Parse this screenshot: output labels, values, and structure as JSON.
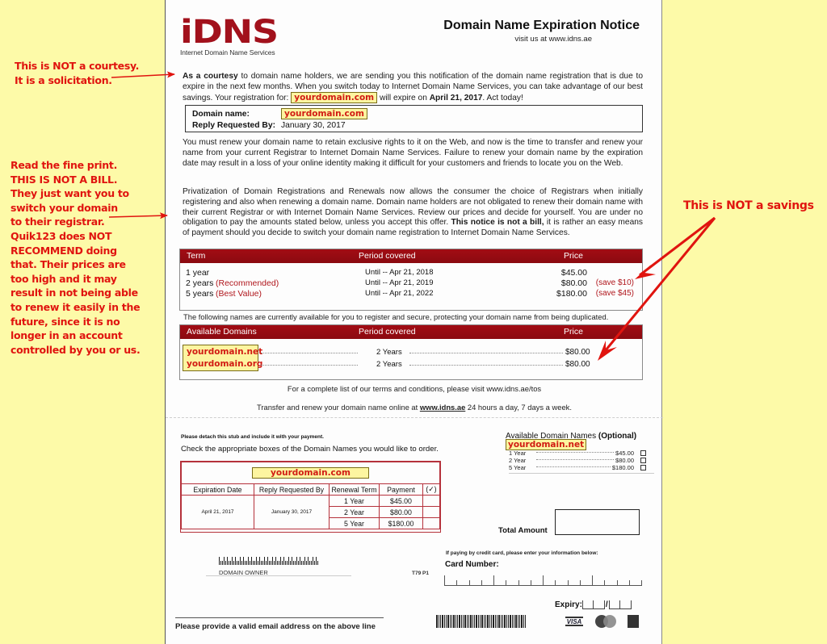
{
  "annotations": {
    "note1": [
      "This is NOT a courtesy.",
      "It is a solicitation."
    ],
    "note2": [
      "Read the fine print.",
      "THIS IS NOT A BILL.",
      "They just want you to",
      "switch your domain",
      "to their registrar.",
      "Quik123 does NOT",
      "RECOMMEND doing",
      "that.  Their prices are",
      "too high and it may",
      "result in not being able",
      "to renew it easily in the",
      "future, since it is no",
      "longer in an account",
      "controlled by you or us."
    ],
    "note3": "This is NOT a savings",
    "accent_color": "#e0140f"
  },
  "header": {
    "logo_text": "iDNS",
    "logo_subtitle": "Internet Domain Name Services",
    "title": "Domain Name Expiration Notice",
    "visit": "visit us at www.idns.ae",
    "brand_color": "#a2111c"
  },
  "intro": {
    "bold_lead": "As a courtesy",
    "text1": " to domain name holders, we are sending you this notification of the domain name registration that is due to expire in the next few months. When you switch today to Internet Domain Name Services, you can take advantage of our best savings. Your registration for: ",
    "domain": "yourdomain.com",
    "text2": " will expire on ",
    "expire_date": "April 21, 2017",
    "text3": ". Act today!"
  },
  "info": {
    "domain_label": "Domain name:",
    "domain_value": "yourdomain.com",
    "reply_label": "Reply Requested By:",
    "reply_value": "January 30, 2017"
  },
  "para2": "You must renew your domain name to retain exclusive rights to it on the Web, and now is the time to transfer and renew your name from your current Registrar to Internet Domain Name Services. Failure to renew your domain name by the expiration date may result in a loss of your online identity making it difficult for your customers and friends to locate you on the Web.",
  "para3": {
    "text1": "Privatization of Domain Registrations and Renewals now allows the consumer the choice of Registrars when initially registering and also when renewing a domain name. Domain name holders are not obligated to renew their domain name with their current Registrar or with Internet Domain Name Services. Review our prices and decide for yourself. You are under no obligation to pay the amounts stated below, unless you accept this offer. ",
    "bold": "This notice is not a bill,",
    "text2": " it is rather an easy means of payment should you decide to switch your domain name registration to Internet Domain Name Services."
  },
  "term_table": {
    "headers": [
      "Term",
      "Period covered",
      "Price"
    ],
    "rows": [
      {
        "term": "1 year",
        "note": "",
        "period": "Until -- Apr 21, 2018",
        "price": "$45.00",
        "save": ""
      },
      {
        "term": "2 years",
        "note": "(Recommended)",
        "period": "Until -- Apr 21, 2019",
        "price": "$80.00",
        "save": "(save $10)"
      },
      {
        "term": "5 years",
        "note": "(Best Value)",
        "period": "Until -- Apr 21, 2022",
        "price": "$180.00",
        "save": "(save $45)"
      }
    ]
  },
  "available_intro": "The following names are currently available for you to register and secure, protecting your domain name from being duplicated.",
  "available_table": {
    "headers": [
      "Available Domains",
      "Period covered",
      "Price"
    ],
    "rows": [
      {
        "domain": "yourdomain.net",
        "period": "2 Years",
        "price": "$80.00"
      },
      {
        "domain": "yourdomain.org",
        "period": "2 Years",
        "price": "$80.00"
      }
    ]
  },
  "terms_line": "For a complete list of our terms and conditions, please visit www.idns.ae/tos",
  "transfer_line": {
    "text1": "Transfer and renew your domain name online at ",
    "link": "www.idns.ae",
    "text2": " 24 hours a day, 7 days a week."
  },
  "stub": {
    "detach": "Please detach this stub and include it with your payment.",
    "check": "Check the appropriate boxes of the Domain Names you would like to order.",
    "domain": "yourdomain.com",
    "headers": [
      "Expiration Date",
      "Reply Requested By",
      "Renewal Term",
      "Payment",
      "(✓)"
    ],
    "expiration": "April 21, 2017",
    "reply": "January 30, 2017",
    "rows": [
      {
        "term": "1 Year",
        "payment": "$45.00"
      },
      {
        "term": "2 Year",
        "payment": "$80.00"
      },
      {
        "term": "5 Year",
        "payment": "$180.00"
      }
    ]
  },
  "optional": {
    "title": "Available Domain Names ",
    "title_bold": "(Optional)",
    "domain": "yourdomain.net",
    "rows": [
      {
        "term": "1 Year",
        "price": "$45.00"
      },
      {
        "term": "2 Year",
        "price": "$80.00"
      },
      {
        "term": "5 Year",
        "price": "$180.00"
      }
    ]
  },
  "total_label": "Total Amount",
  "owner_label": "DOMAIN OWNER",
  "code": "T79  P1",
  "card": {
    "intro": "If paying by credit card, please enter your information below:",
    "number_label": "Card Number:",
    "expiry_label": "Expiry:",
    "logos": [
      "VISA",
      "MasterCard",
      "AMEX"
    ]
  },
  "email_line": "Please provide a valid email address on the above line"
}
